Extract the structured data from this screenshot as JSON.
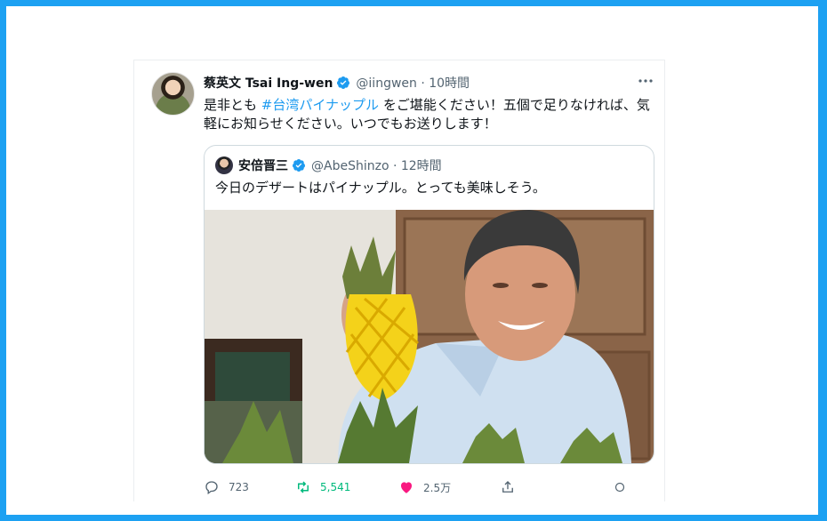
{
  "tweet": {
    "author_name": "蔡英文 Tsai Ing-wen",
    "author_handle": "@iingwen",
    "time": "10時間",
    "meta": "@iingwen · 10時間",
    "text_before": "是非とも ",
    "hashtag": "#台湾パイナップル",
    "text_after": " をご堪能ください！五個で足りなければ、気軽にお知らせください。いつでもお送りします！"
  },
  "quote": {
    "author_name": "安倍晋三",
    "author_handle": "@AbeShinzo",
    "time": "12時間",
    "meta": "@AbeShinzo · 12時間",
    "text": "今日のデザートはパイナップル。とっても美味しそう。"
  },
  "actions": {
    "reply_count": "723",
    "retweet_count": "5,541",
    "like_count": "2.5万"
  },
  "icons": [
    "verified-icon",
    "more-icon",
    "reply-icon",
    "retweet-icon",
    "like-icon",
    "share-icon",
    "circle-icon"
  ],
  "colors": {
    "brand": "#1da1f2",
    "link": "#1d9bf0",
    "retweet": "#00ba7c",
    "like": "#f91880"
  }
}
